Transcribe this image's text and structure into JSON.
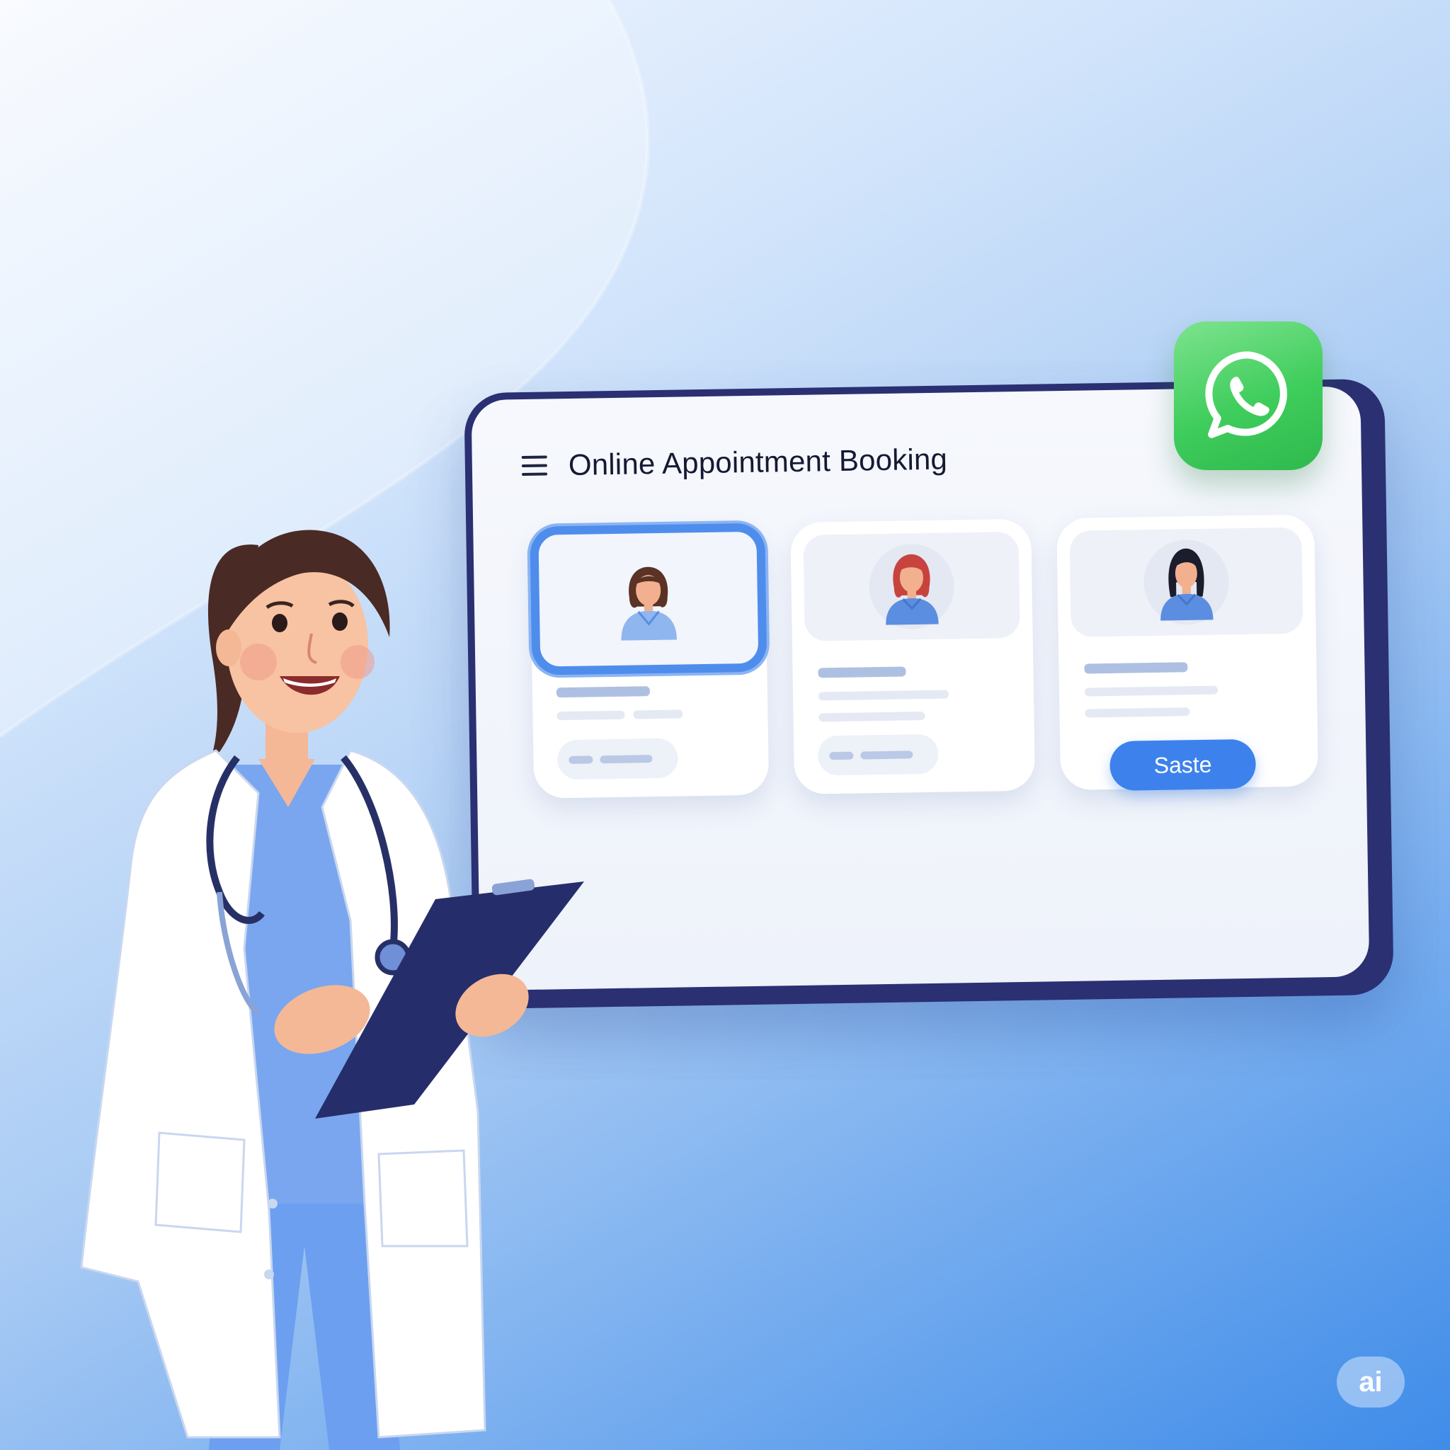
{
  "app": {
    "title": "Online Appointment Booking",
    "menu_icon": "hamburger-menu-icon"
  },
  "doctor_cards": [
    {
      "selected": true,
      "avatar_hair_color": "#5a3326"
    },
    {
      "selected": false,
      "avatar_hair_color": "#c8433e"
    },
    {
      "selected": false,
      "avatar_hair_color": "#1b1c2c",
      "action_label": "Saste"
    }
  ],
  "overlay": {
    "whatsapp_icon": "whatsapp-icon",
    "ai_badge_label": "ai"
  },
  "colors": {
    "accent": "#3d82ec",
    "tablet_frame": "#2a3072",
    "whatsapp_green": "#3fcd5c",
    "scrubs": "#6c9ff0"
  }
}
